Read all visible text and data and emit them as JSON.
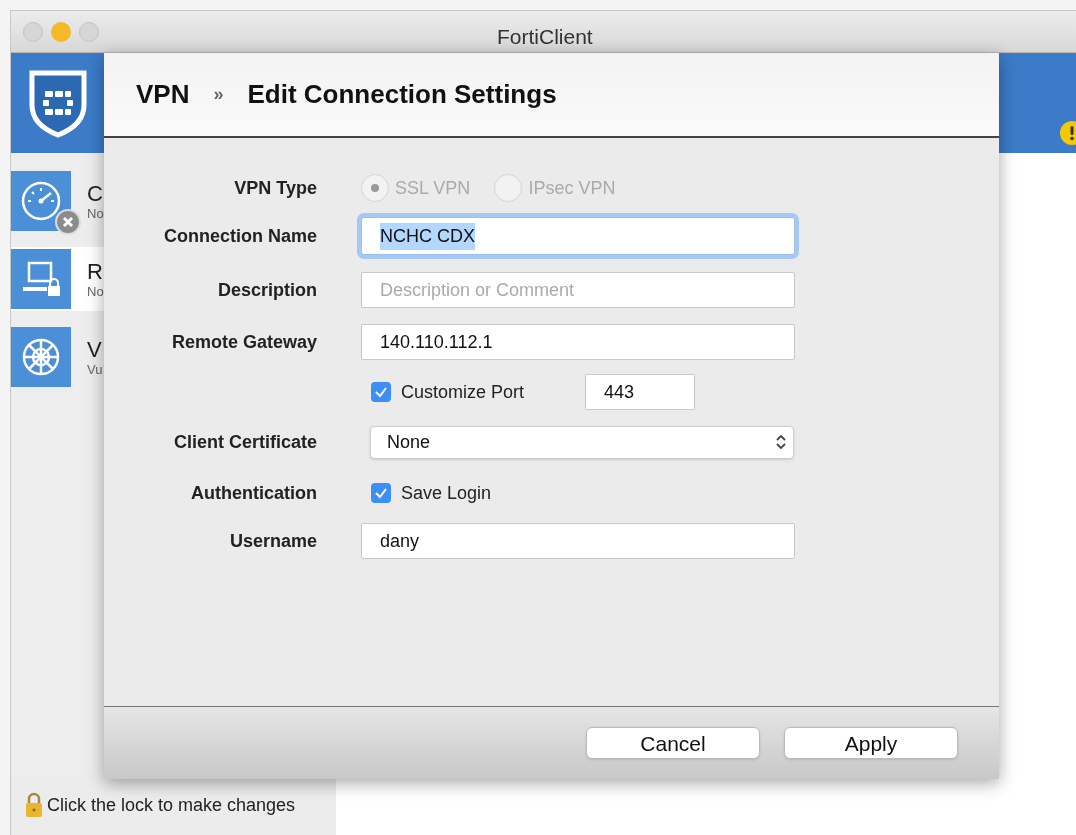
{
  "window": {
    "title": "FortiClient"
  },
  "sidebar": {
    "items": [
      {
        "kind": "gauge",
        "title": "C",
        "subtitle": "No",
        "selected": false,
        "error_badge": true
      },
      {
        "kind": "computer",
        "title": "R",
        "subtitle": "No",
        "selected": true,
        "error_badge": false
      },
      {
        "kind": "wheel",
        "title": "V",
        "subtitle": "Vu",
        "selected": false,
        "error_badge": false
      }
    ]
  },
  "lock_bar": {
    "text": "Click the lock to make changes"
  },
  "header": {
    "warning": true
  },
  "dialog": {
    "breadcrumb": [
      "VPN",
      "»",
      "Edit Connection Settings"
    ],
    "form": [
      {
        "kind": "radio",
        "label": "VPN Type",
        "disabled": true,
        "options": [
          {
            "label": "SSL VPN",
            "selected": true
          },
          {
            "label": "IPsec VPN",
            "selected": false
          }
        ]
      },
      {
        "kind": "text",
        "label": "Connection Name",
        "value": "NCHC CDX",
        "focused": true,
        "text_selected": true
      },
      {
        "kind": "text",
        "label": "Description",
        "placeholder": "Description or Comment",
        "focused": false,
        "text_selected": false
      },
      {
        "kind": "text",
        "label": "Remote Gateway",
        "value": "140.110.112.1",
        "focused": false,
        "text_selected": false
      },
      {
        "kind": "port",
        "checkbox": "Customize Port",
        "checked": true,
        "value": "443"
      },
      {
        "kind": "select",
        "label": "Client Certificate",
        "value": "None"
      },
      {
        "kind": "checkbox",
        "label": "Authentication",
        "checkbox": "Save Login",
        "checked": true
      },
      {
        "kind": "text",
        "label": "Username",
        "value": "dany",
        "focused": false,
        "text_selected": false
      }
    ],
    "buttons": [
      "Cancel",
      "Apply"
    ]
  }
}
